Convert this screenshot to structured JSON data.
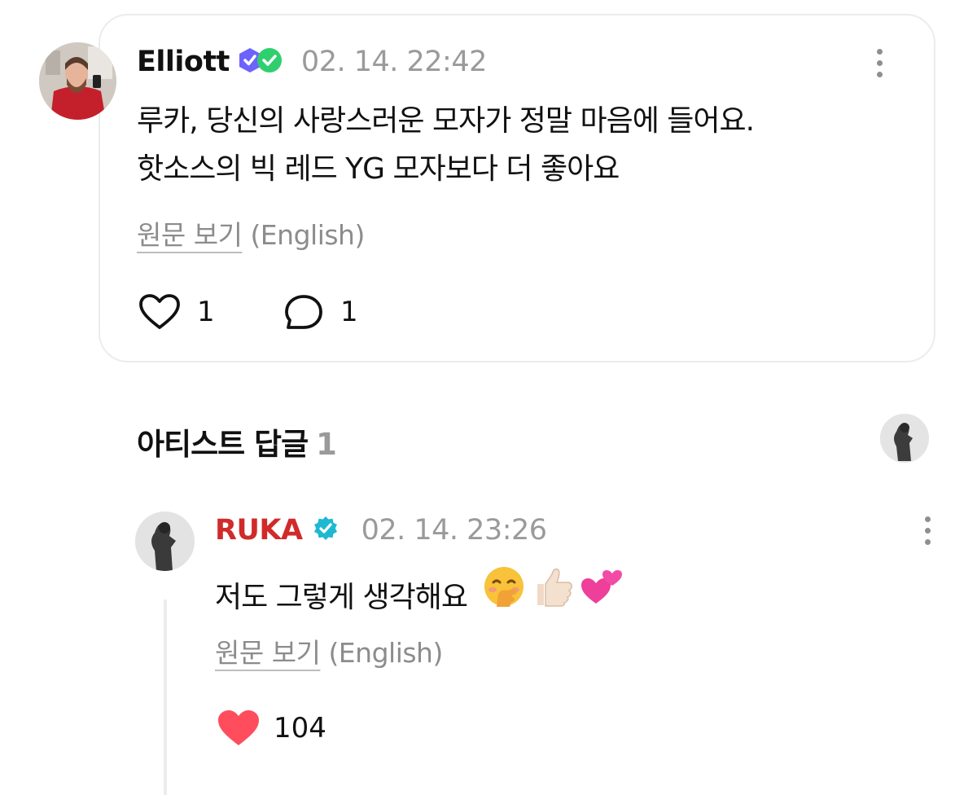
{
  "comment": {
    "author": "Elliott",
    "timestamp": "02. 14. 22:42",
    "text_line1": "루카, 당신의 사랑스러운 모자가 정말 마음에 들어요.",
    "text_line2": "핫소스의 빅 레드 YG 모자보다 더 좋아요",
    "view_original": "원문 보기",
    "original_language": "(English)",
    "like_count": "1",
    "reply_count": "1"
  },
  "artist_replies": {
    "title": "아티스트 답글",
    "count": "1"
  },
  "reply": {
    "author": "RUKA",
    "timestamp": "02. 14. 23:26",
    "text": "저도 그렇게 생각해요",
    "emojis": "🤭👍🏻💕",
    "view_original": "원문 보기",
    "original_language": "(English)",
    "like_count": "104"
  },
  "colors": {
    "artist_name": "#d12a2a",
    "like_active": "#ff4d5e",
    "verified_badge": "#1fb8d3",
    "muted_text": "#9a9a9a"
  }
}
